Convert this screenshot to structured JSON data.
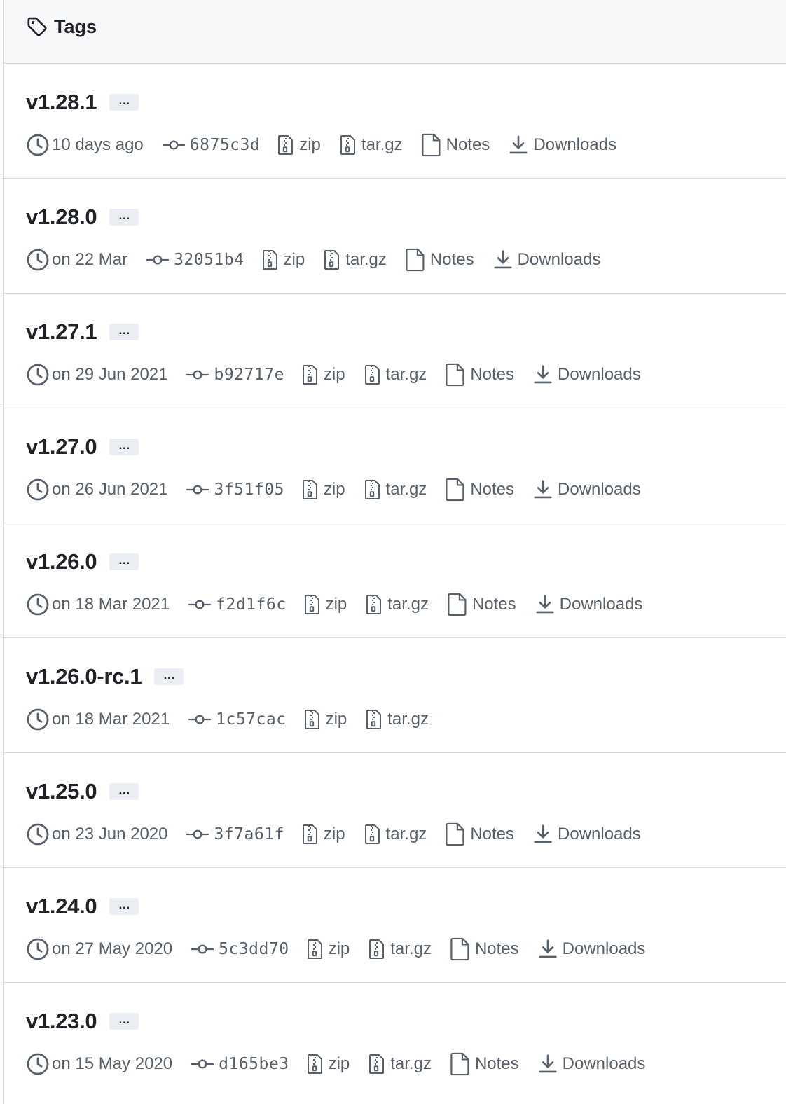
{
  "header": {
    "title": "Tags",
    "icon": "tag-icon"
  },
  "ellipsis_label": "…",
  "labels": {
    "zip": "zip",
    "targz": "tar.gz",
    "notes": "Notes",
    "downloads": "Downloads"
  },
  "tags": [
    {
      "name": "v1.28.1",
      "date": "10 days ago",
      "commit": "6875c3d",
      "notes": true,
      "downloads": true
    },
    {
      "name": "v1.28.0",
      "date": "on 22 Mar",
      "commit": "32051b4",
      "notes": true,
      "downloads": true
    },
    {
      "name": "v1.27.1",
      "date": "on 29 Jun 2021",
      "commit": "b92717e",
      "notes": true,
      "downloads": true
    },
    {
      "name": "v1.27.0",
      "date": "on 26 Jun 2021",
      "commit": "3f51f05",
      "notes": true,
      "downloads": true
    },
    {
      "name": "v1.26.0",
      "date": "on 18 Mar 2021",
      "commit": "f2d1f6c",
      "notes": true,
      "downloads": true
    },
    {
      "name": "v1.26.0-rc.1",
      "date": "on 18 Mar 2021",
      "commit": "1c57cac",
      "notes": false,
      "downloads": false
    },
    {
      "name": "v1.25.0",
      "date": "on 23 Jun 2020",
      "commit": "3f7a61f",
      "notes": true,
      "downloads": true
    },
    {
      "name": "v1.24.0",
      "date": "on 27 May 2020",
      "commit": "5c3dd70",
      "notes": true,
      "downloads": true
    },
    {
      "name": "v1.23.0",
      "date": "on 15 May 2020",
      "commit": "d165be3",
      "notes": true,
      "downloads": true
    }
  ]
}
